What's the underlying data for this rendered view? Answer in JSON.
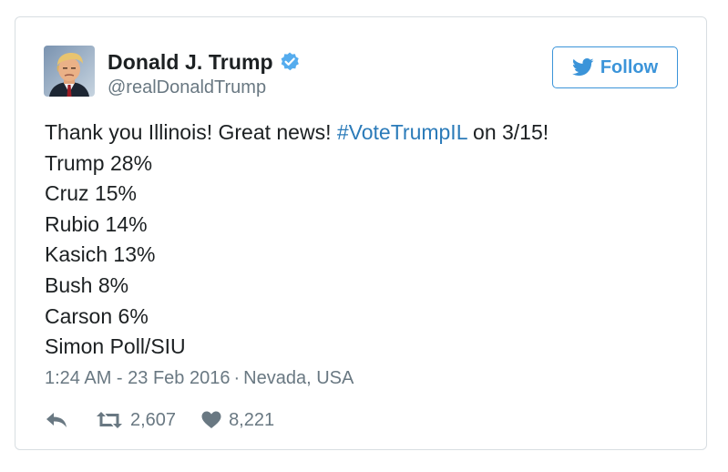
{
  "user": {
    "display_name": "Donald J. Trump",
    "handle": "@realDonaldTrump",
    "verified": true
  },
  "follow_button": {
    "label": "Follow",
    "icon": "twitter-bird-icon"
  },
  "tweet": {
    "intro": "Thank you Illinois! Great news!",
    "hashtag": "#VoteTrumpIL",
    "intro_suffix": "on 3/15!",
    "lines": [
      "Trump 28%",
      "Cruz 15%",
      "Rubio 14%",
      "Kasich 13%",
      "Bush 8%",
      "Carson 6%",
      "Simon Poll/SIU"
    ]
  },
  "meta": {
    "timestamp": "1:24 AM - 23 Feb 2016",
    "separator": "·",
    "location": "Nevada, USA"
  },
  "actions": {
    "reply_icon": "reply-icon",
    "retweet_icon": "retweet-icon",
    "retweet_count": "2,607",
    "like_icon": "heart-icon",
    "like_count": "8,221"
  },
  "colors": {
    "link": "#2b7bb9",
    "follow_accent": "#3b94d9",
    "secondary_text": "#697882",
    "primary_text": "#1c2022",
    "verified": "#55acee",
    "border": "#d8dee2"
  }
}
